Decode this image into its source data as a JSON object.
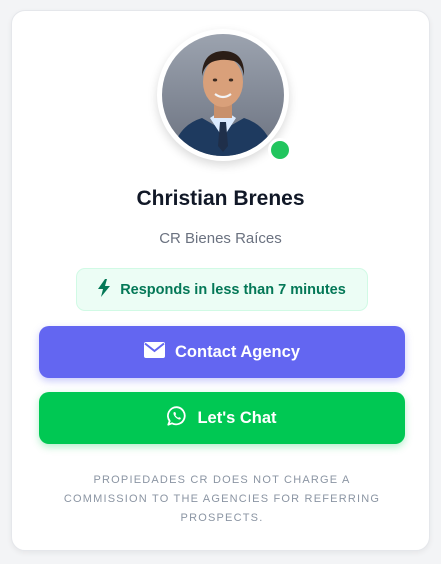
{
  "agent": {
    "name": "Christian Brenes",
    "agency": "CR Bienes Raíces",
    "online": true,
    "status_color": "#22c55e"
  },
  "response_badge": {
    "icon": "lightning-bolt-icon",
    "text": "Responds in less than 7 minutes"
  },
  "actions": {
    "contact": {
      "label": "Contact Agency",
      "icon": "envelope-icon",
      "color": "#6366f1"
    },
    "chat": {
      "label": "Let's Chat",
      "icon": "whatsapp-icon",
      "color": "#00c853"
    }
  },
  "disclaimer": "PROPIEDADES CR DOES NOT CHARGE A COMMISSION TO THE AGENCIES FOR REFERRING PROSPECTS."
}
